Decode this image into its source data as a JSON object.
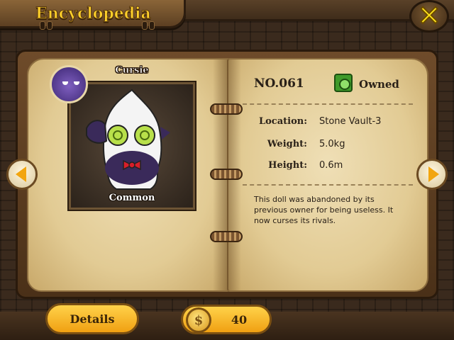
{
  "header": {
    "title": "Encyclopedia",
    "close_icon": "close-x-icon"
  },
  "creature": {
    "name": "Cursie",
    "rarity": "Common",
    "number": "NO.061",
    "status": "Owned",
    "avatar_icon": "cursie-avatar-icon",
    "status_icon": "owned-badge-icon"
  },
  "stats": [
    {
      "label": "Location:",
      "value": "Stone Vault-3"
    },
    {
      "label": "Weight:",
      "value": "5.0kg"
    },
    {
      "label": "Height:",
      "value": "0.6m"
    }
  ],
  "description": "This doll was abandoned by its previous owner for being useless. It now curses its rivals.",
  "navigation": {
    "prev_icon": "arrow-left-icon",
    "next_icon": "arrow-right-icon"
  },
  "footer": {
    "details_label": "Details",
    "coin_count": "40",
    "coin_icon": "coin-icon"
  },
  "colors": {
    "accent": "#f2a50f",
    "title": "#ffd12a",
    "owned": "#3f9a2a"
  }
}
